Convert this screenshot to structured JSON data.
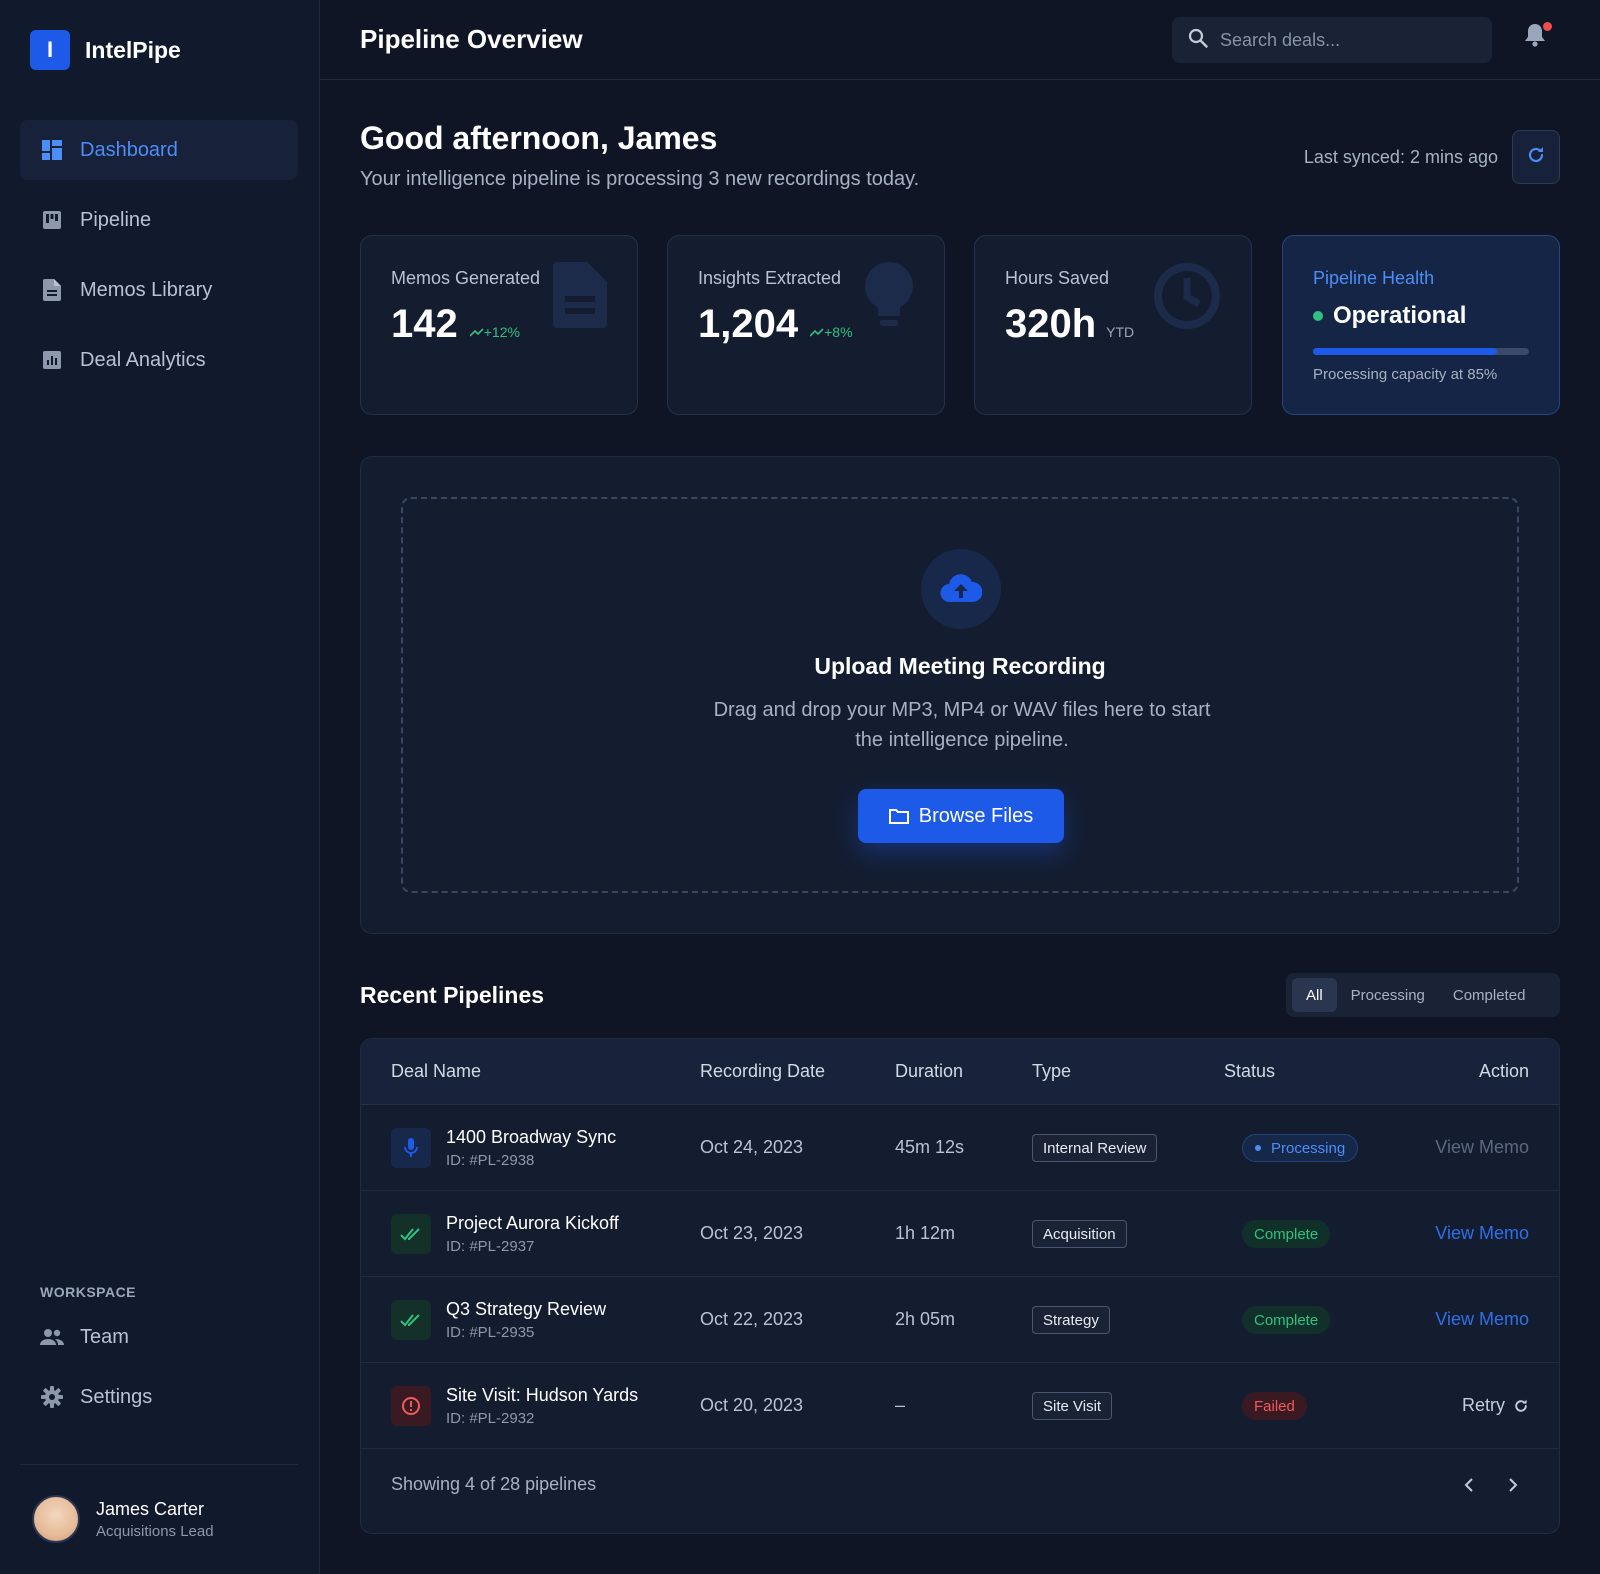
{
  "app": {
    "logo_letter": "I",
    "name": "IntelPipe"
  },
  "sidebar": {
    "nav": [
      {
        "label": "Dashboard",
        "icon": "dashboard-icon",
        "active": true
      },
      {
        "label": "Pipeline",
        "icon": "pipeline-icon",
        "active": false
      },
      {
        "label": "Memos Library",
        "icon": "document-icon",
        "active": false
      },
      {
        "label": "Deal Analytics",
        "icon": "analytics-icon",
        "active": false
      }
    ],
    "workspace_title": "WORKSPACE",
    "workspace": [
      {
        "label": "Team",
        "icon": "team-icon"
      },
      {
        "label": "Settings",
        "icon": "gear-icon"
      }
    ],
    "user": {
      "name": "James Carter",
      "role": "Acquisitions Lead"
    }
  },
  "header": {
    "title": "Pipeline Overview",
    "search_placeholder": "Search deals...",
    "notification_unread": true
  },
  "greeting": {
    "title": "Good afternoon, James",
    "subtitle": "Your intelligence pipeline is processing 3 new recordings today.",
    "last_synced": "Last synced: 2 mins ago"
  },
  "stats": [
    {
      "label": "Memos Generated",
      "value": "142",
      "delta": "+12%",
      "icon": "document-icon"
    },
    {
      "label": "Insights Extracted",
      "value": "1,204",
      "delta": "+8%",
      "icon": "lightbulb-icon"
    },
    {
      "label": "Hours Saved",
      "value": "320h",
      "unit": "YTD",
      "icon": "clock-icon"
    }
  ],
  "health": {
    "label": "Pipeline Health",
    "status": "Operational",
    "capacity": 0.85,
    "note": "Processing capacity at 85%"
  },
  "upload": {
    "title": "Upload Meeting Recording",
    "description": "Drag and drop your MP3, MP4 or WAV files here to start the intelligence pipeline.",
    "button": "Browse Files"
  },
  "recent": {
    "title": "Recent Pipelines",
    "filters": [
      "All",
      "Processing",
      "Completed"
    ],
    "active_filter": "All",
    "columns": [
      "Deal Name",
      "Recording Date",
      "Duration",
      "Type",
      "Status",
      "Action"
    ],
    "rows": [
      {
        "name": "1400 Broadway Sync",
        "id": "ID: #PL-2938",
        "date": "Oct 24, 2023",
        "duration": "45m 12s",
        "type": "Internal Review",
        "status": "Processing",
        "action": "View Memo",
        "icon": "microphone-icon"
      },
      {
        "name": "Project Aurora Kickoff",
        "id": "ID: #PL-2937",
        "date": "Oct 23, 2023",
        "duration": "1h 12m",
        "type": "Acquisition",
        "status": "Complete",
        "action": "View Memo",
        "icon": "double-check-icon"
      },
      {
        "name": "Q3 Strategy Review",
        "id": "ID: #PL-2935",
        "date": "Oct 22, 2023",
        "duration": "2h 05m",
        "type": "Strategy",
        "status": "Complete",
        "action": "View Memo",
        "icon": "double-check-icon"
      },
      {
        "name": "Site Visit: Hudson Yards",
        "id": "ID: #PL-2932",
        "date": "Oct 20, 2023",
        "duration": "–",
        "type": "Site Visit",
        "status": "Failed",
        "action": "Retry",
        "icon": "error-icon"
      }
    ],
    "footer": "Showing 4 of 28 pipelines"
  },
  "colors": {
    "accent": "#1d5ae8",
    "link": "#4d8df6",
    "success": "#2ec27e",
    "danger": "#ef5a5a",
    "background": "#0f1524",
    "sidebar": "#111a2c"
  }
}
